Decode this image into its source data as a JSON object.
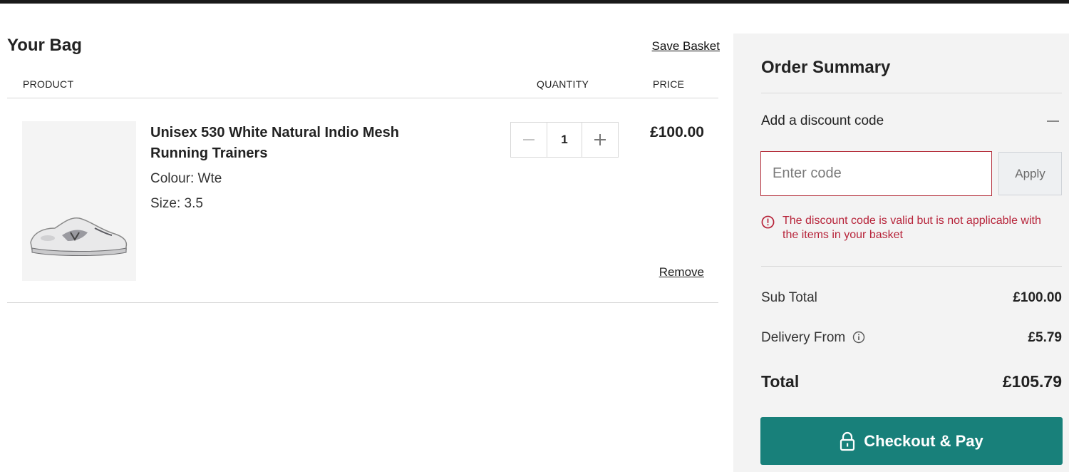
{
  "bag": {
    "title": "Your Bag",
    "save_basket_label": "Save Basket",
    "columns": {
      "product": "PRODUCT",
      "quantity": "QUANTITY",
      "price": "PRICE"
    },
    "items": [
      {
        "name": "Unisex 530 White Natural Indio Mesh Running Trainers",
        "colour": "Colour: Wte",
        "size": "Size: 3.5",
        "quantity": "1",
        "price": "£100.00",
        "remove_label": "Remove",
        "image": "sneaker-image"
      }
    ]
  },
  "summary": {
    "title": "Order Summary",
    "discount": {
      "label": "Add a discount code",
      "placeholder": "Enter code",
      "apply_label": "Apply",
      "error": "The discount code is valid but is not applicable with the items in your basket"
    },
    "subtotal_label": "Sub Total",
    "subtotal_value": "£100.00",
    "delivery_label": "Delivery From",
    "delivery_value": "£5.79",
    "total_label": "Total",
    "total_value": "£105.79",
    "checkout_label": "Checkout & Pay"
  },
  "colors": {
    "accent": "#18807a",
    "error": "#b7243a",
    "summary_bg": "#f3f3f3"
  },
  "icons": [
    "minus-icon",
    "plus-icon",
    "collapse-icon",
    "error-icon",
    "info-icon",
    "lock-icon"
  ]
}
